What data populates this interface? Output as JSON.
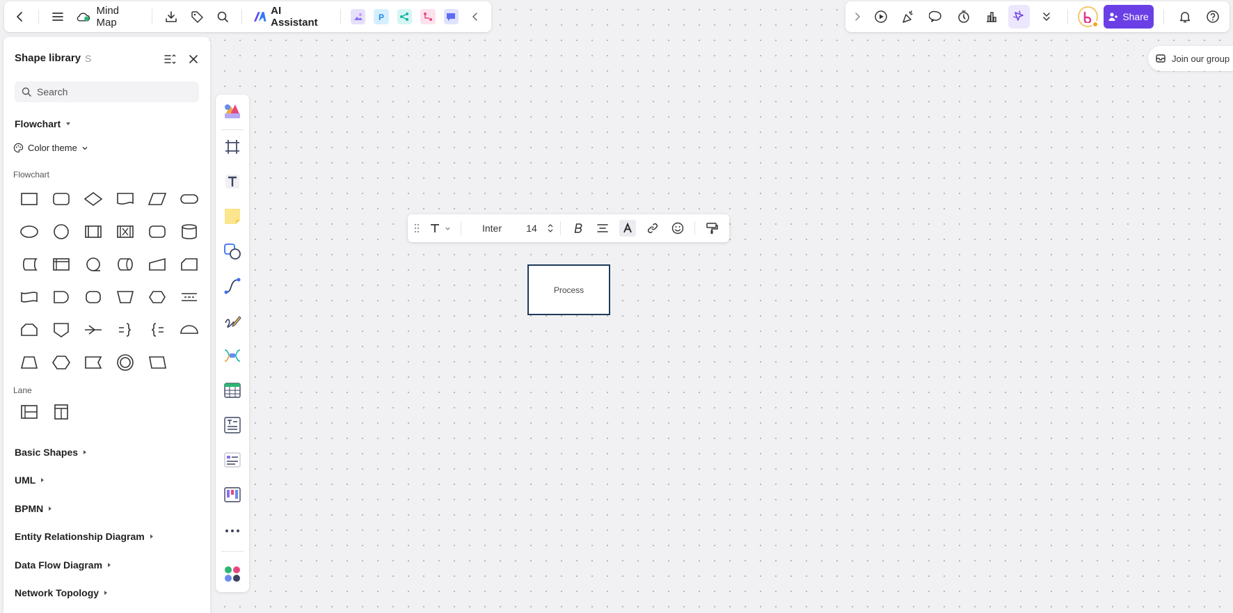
{
  "app": {
    "doc_title": "Mind Map",
    "ai_assistant_label": "AI Assistant",
    "share_label": "Share",
    "join_group_label": "Join our group"
  },
  "shape_library": {
    "title": "Shape library",
    "shortcut": "S",
    "search_placeholder": "Search",
    "current_library": "Flowchart",
    "color_theme_label": "Color theme",
    "categories": {
      "flowchart": "Flowchart",
      "lane": "Lane"
    },
    "collapsed_sections": [
      "Basic Shapes",
      "UML",
      "BPMN",
      "Entity Relationship Diagram",
      "Data Flow Diagram",
      "Network Topology"
    ]
  },
  "text_toolbar": {
    "font_family": "Inter",
    "font_size": "14"
  },
  "canvas": {
    "process_label": "Process"
  },
  "colors": {
    "accent": "#6a3fe6",
    "shape_border": "#1c3a5c",
    "canvas_bg": "#f1f1f3"
  }
}
